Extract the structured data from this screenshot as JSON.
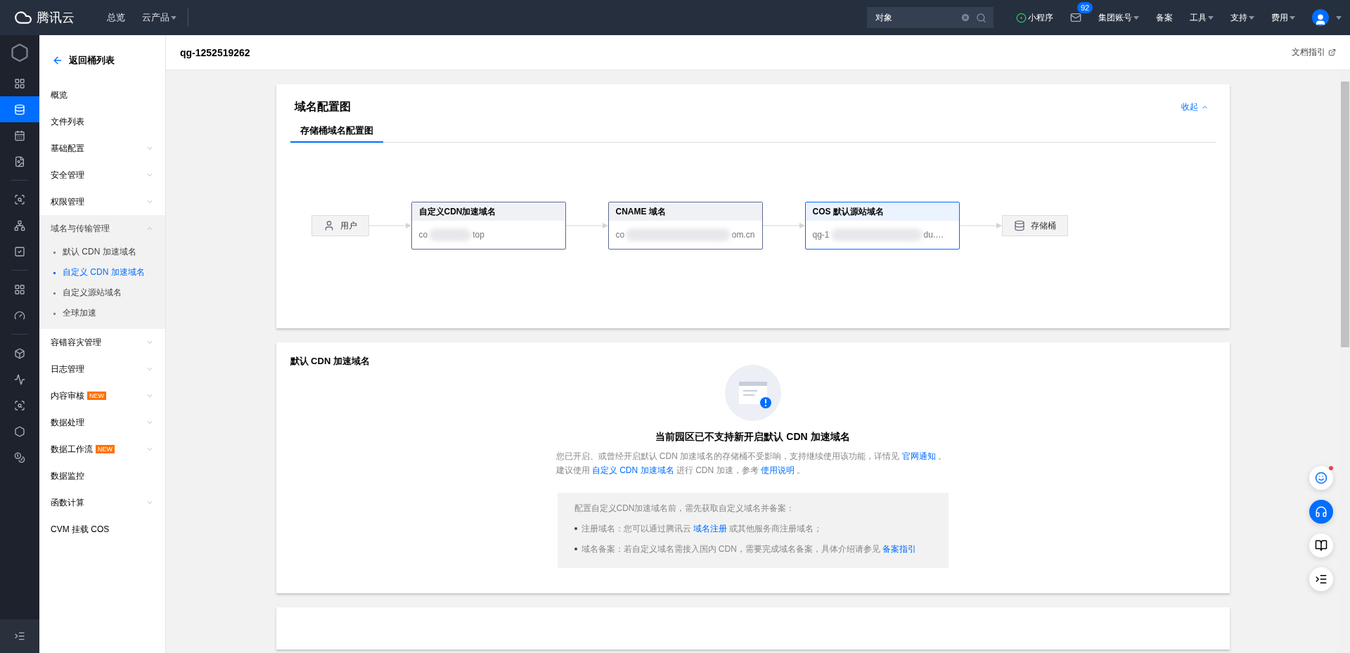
{
  "topbar": {
    "brand": "腾讯云",
    "nav": [
      {
        "label": "总览",
        "dropdown": false
      },
      {
        "label": "云产品",
        "dropdown": true
      }
    ],
    "search": {
      "value": "对象"
    },
    "mini_program": "小程序",
    "mail_badge": "92",
    "menus": [
      {
        "label": "集团账号",
        "dropdown": true
      },
      {
        "label": "备案",
        "dropdown": false
      },
      {
        "label": "工具",
        "dropdown": true
      },
      {
        "label": "支持",
        "dropdown": true
      },
      {
        "label": "费用",
        "dropdown": true
      }
    ]
  },
  "rail_groups": [
    {
      "items": [
        {
          "selected": false
        },
        {
          "selected": true
        },
        {
          "selected": false
        },
        {
          "selected": false
        }
      ]
    },
    {
      "items": [
        {
          "selected": false
        },
        {
          "selected": false
        },
        {
          "selected": false
        }
      ]
    },
    {
      "items": [
        {
          "selected": false
        },
        {
          "selected": false
        }
      ]
    },
    {
      "items": [
        {
          "selected": false
        },
        {
          "selected": false
        },
        {
          "selected": false
        },
        {
          "selected": false
        },
        {
          "selected": false
        }
      ]
    }
  ],
  "sidebar": {
    "back": "返回桶列表",
    "items": [
      {
        "label": "概览",
        "expandable": false,
        "expanded": false
      },
      {
        "label": "文件列表",
        "expandable": false,
        "expanded": false
      },
      {
        "label": "基础配置",
        "expandable": true,
        "expanded": false
      },
      {
        "label": "安全管理",
        "expandable": true,
        "expanded": false
      },
      {
        "label": "权限管理",
        "expandable": true,
        "expanded": false
      },
      {
        "label": "域名与传输管理",
        "expandable": true,
        "expanded": true,
        "children": [
          {
            "label": "默认 CDN 加速域名",
            "selected": false
          },
          {
            "label": "自定义 CDN 加速域名",
            "selected": true
          },
          {
            "label": "自定义源站域名",
            "selected": false
          },
          {
            "label": "全球加速",
            "selected": false
          }
        ]
      },
      {
        "label": "容错容灾管理",
        "expandable": true,
        "expanded": false
      },
      {
        "label": "日志管理",
        "expandable": true,
        "expanded": false
      },
      {
        "label": "内容审核",
        "badge": "NEW",
        "expandable": true,
        "expanded": false
      },
      {
        "label": "数据处理",
        "expandable": true,
        "expanded": false
      },
      {
        "label": "数据工作流",
        "badge": "NEW",
        "expandable": true,
        "expanded": false
      },
      {
        "label": "数据监控",
        "expandable": false,
        "expanded": false
      },
      {
        "label": "函数计算",
        "expandable": true,
        "expanded": false
      },
      {
        "label": "CVM 挂载 COS",
        "expandable": false,
        "expanded": false
      }
    ]
  },
  "header": {
    "title": "qg-1252519262",
    "doc_link": "文档指引"
  },
  "diagram_card": {
    "title": "域名配置图",
    "collapse": "收起",
    "tabs": [
      {
        "label": "存储桶域名配置图",
        "selected": true
      }
    ],
    "nodes": [
      {
        "kind": "user",
        "label": "用户"
      },
      {
        "kind": "domain",
        "title": "自定义CDN加速域名",
        "value_start": "co",
        "value_end": "top",
        "highlighted": false
      },
      {
        "kind": "domain",
        "title": "CNAME 域名",
        "value_start": "co",
        "value_end": "om.cn",
        "highlighted": false
      },
      {
        "kind": "domain",
        "title": "COS 默认源站域名",
        "value_start": "qg-1",
        "value_end": "du.…",
        "highlighted": true
      },
      {
        "kind": "bucket",
        "label": "存储桶"
      }
    ]
  },
  "cdn_card": {
    "title": "默认 CDN 加速域名",
    "heading": "当前园区已不支持新开启默认 CDN 加速域名",
    "paragraphs": [
      [
        {
          "text": "您已开启、或曾经开启默认 CDN 加速域名的存储桶不受影响，支持继续使用该功能，详情见 "
        },
        {
          "link": "官网通知"
        },
        {
          "text": " 。"
        }
      ],
      [
        {
          "text": "建议使用 "
        },
        {
          "link": "自定义 CDN 加速域名"
        },
        {
          "text": " 进行 CDN 加速，参考 "
        },
        {
          "link": "使用说明"
        },
        {
          "text": " 。"
        }
      ]
    ],
    "note": {
      "intro": "配置自定义CDN加速域名前，需先获取自定义域名并备案：",
      "bullets": [
        [
          {
            "text": "注册域名：您可以通过腾讯云 "
          },
          {
            "link": "域名注册"
          },
          {
            "text": " 或其他服务商注册域名；"
          }
        ],
        [
          {
            "text": "域名备案：若自定义域名需接入国内 CDN，需要完成域名备案，具体介绍请参见 "
          },
          {
            "link": "备案指引"
          }
        ]
      ]
    }
  },
  "float_buttons": [
    {
      "kind": "smile",
      "notified": true
    },
    {
      "kind": "support",
      "notified": false
    },
    {
      "kind": "book",
      "notified": false
    },
    {
      "kind": "list",
      "notified": false
    }
  ]
}
